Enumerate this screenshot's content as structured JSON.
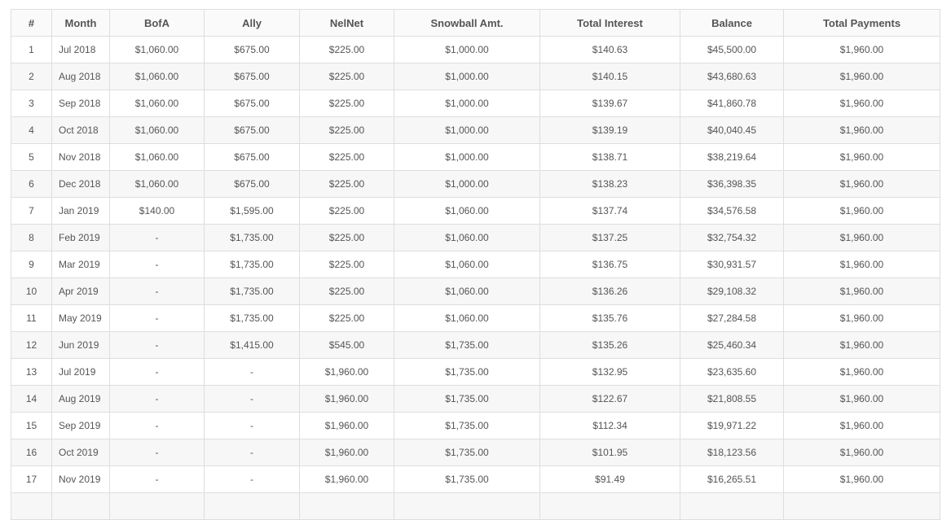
{
  "table": {
    "headers": [
      "#",
      "Month",
      "BofA",
      "Ally",
      "NelNet",
      "Snowball Amt.",
      "Total Interest",
      "Balance",
      "Total Payments"
    ],
    "rows": [
      [
        "1",
        "Jul 2018",
        "$1,060.00",
        "$675.00",
        "$225.00",
        "$1,000.00",
        "$140.63",
        "$45,500.00",
        "$1,960.00"
      ],
      [
        "2",
        "Aug 2018",
        "$1,060.00",
        "$675.00",
        "$225.00",
        "$1,000.00",
        "$140.15",
        "$43,680.63",
        "$1,960.00"
      ],
      [
        "3",
        "Sep 2018",
        "$1,060.00",
        "$675.00",
        "$225.00",
        "$1,000.00",
        "$139.67",
        "$41,860.78",
        "$1,960.00"
      ],
      [
        "4",
        "Oct 2018",
        "$1,060.00",
        "$675.00",
        "$225.00",
        "$1,000.00",
        "$139.19",
        "$40,040.45",
        "$1,960.00"
      ],
      [
        "5",
        "Nov 2018",
        "$1,060.00",
        "$675.00",
        "$225.00",
        "$1,000.00",
        "$138.71",
        "$38,219.64",
        "$1,960.00"
      ],
      [
        "6",
        "Dec 2018",
        "$1,060.00",
        "$675.00",
        "$225.00",
        "$1,000.00",
        "$138.23",
        "$36,398.35",
        "$1,960.00"
      ],
      [
        "7",
        "Jan 2019",
        "$140.00",
        "$1,595.00",
        "$225.00",
        "$1,060.00",
        "$137.74",
        "$34,576.58",
        "$1,960.00"
      ],
      [
        "8",
        "Feb 2019",
        "-",
        "$1,735.00",
        "$225.00",
        "$1,060.00",
        "$137.25",
        "$32,754.32",
        "$1,960.00"
      ],
      [
        "9",
        "Mar 2019",
        "-",
        "$1,735.00",
        "$225.00",
        "$1,060.00",
        "$136.75",
        "$30,931.57",
        "$1,960.00"
      ],
      [
        "10",
        "Apr 2019",
        "-",
        "$1,735.00",
        "$225.00",
        "$1,060.00",
        "$136.26",
        "$29,108.32",
        "$1,960.00"
      ],
      [
        "11",
        "May 2019",
        "-",
        "$1,735.00",
        "$225.00",
        "$1,060.00",
        "$135.76",
        "$27,284.58",
        "$1,960.00"
      ],
      [
        "12",
        "Jun 2019",
        "-",
        "$1,415.00",
        "$545.00",
        "$1,735.00",
        "$135.26",
        "$25,460.34",
        "$1,960.00"
      ],
      [
        "13",
        "Jul 2019",
        "-",
        "-",
        "$1,960.00",
        "$1,735.00",
        "$132.95",
        "$23,635.60",
        "$1,960.00"
      ],
      [
        "14",
        "Aug 2019",
        "-",
        "-",
        "$1,960.00",
        "$1,735.00",
        "$122.67",
        "$21,808.55",
        "$1,960.00"
      ],
      [
        "15",
        "Sep 2019",
        "-",
        "-",
        "$1,960.00",
        "$1,735.00",
        "$112.34",
        "$19,971.22",
        "$1,960.00"
      ],
      [
        "16",
        "Oct 2019",
        "-",
        "-",
        "$1,960.00",
        "$1,735.00",
        "$101.95",
        "$18,123.56",
        "$1,960.00"
      ],
      [
        "17",
        "Nov 2019",
        "-",
        "-",
        "$1,960.00",
        "$1,735.00",
        "$91.49",
        "$16,265.51",
        "$1,960.00"
      ],
      [
        "",
        "",
        "",
        "",
        "",
        "",
        "",
        "",
        ""
      ]
    ]
  }
}
